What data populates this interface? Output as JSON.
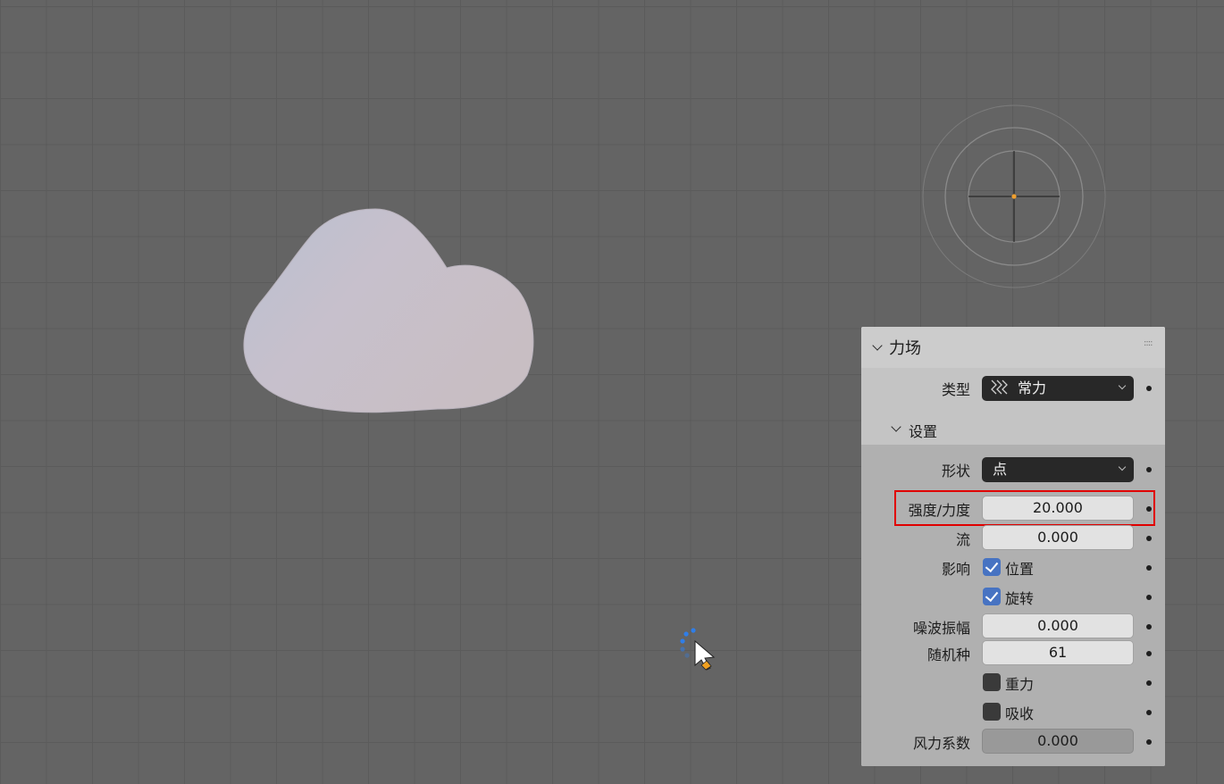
{
  "colors": {
    "viewport_bg": "#646464",
    "grid_line": "#5b5b5b",
    "panel_bg": "#c4c4c4",
    "checkbox_on": "#4773c2",
    "highlight": "#e00000",
    "origin": "#f0a030"
  },
  "panel": {
    "title": "力场",
    "drag_handle": "::::",
    "type": {
      "label": "类型",
      "value": "常力",
      "icon": "wind-force-icon"
    },
    "settings": {
      "title": "设置",
      "shape": {
        "label": "形状",
        "value": "点"
      },
      "strength": {
        "label": "强度/力度",
        "value": "20.000"
      },
      "flow": {
        "label": "流",
        "value": "0.000"
      },
      "affect": {
        "label": "影响",
        "location": {
          "label": "位置",
          "checked": true
        },
        "rotation": {
          "label": "旋转",
          "checked": true
        }
      },
      "noise_amount": {
        "label": "噪波振幅",
        "value": "0.000"
      },
      "seed": {
        "label": "随机种",
        "value": "61"
      },
      "gravitation": {
        "label": "重力",
        "checked": false
      },
      "absorption": {
        "label": "吸收",
        "checked": false
      },
      "wind_factor": {
        "label": "风力系数",
        "value": "0.000"
      }
    }
  }
}
